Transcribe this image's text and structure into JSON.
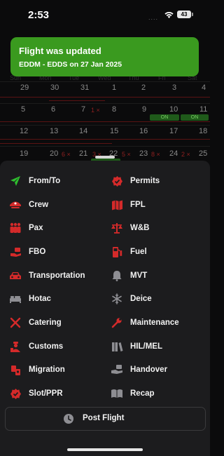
{
  "status_bar": {
    "time": "2:53",
    "signal": "....",
    "battery": "43"
  },
  "calendar": {
    "day_headers": [
      "Sun",
      "Mon",
      "Tue",
      "Wed",
      "Thu",
      "Fri",
      "Sat"
    ],
    "weeks": [
      [
        "29",
        "30",
        "31",
        "1",
        "2",
        "3",
        "4"
      ],
      [
        "5",
        "6",
        "7",
        "8",
        "9",
        "10",
        "11"
      ],
      [
        "12",
        "13",
        "14",
        "15",
        "16",
        "17",
        "18"
      ],
      [
        "19",
        "20",
        "21",
        "22",
        "23",
        "24",
        "25"
      ]
    ],
    "badges": {
      "w2_tue": "1 ×",
      "w4_mon": "6 ×",
      "w4_wed": "3 ×",
      "w4_thu": "5 ×",
      "w4_fri": "8 ×",
      "w4_sat": "2 ×"
    },
    "events": {
      "ev_fri": "ON",
      "ev_sat": "ON"
    }
  },
  "toast": {
    "title": "Flight was updated",
    "subtitle": "EDDM - EDDS on 27 Jan 2025"
  },
  "menu": {
    "left": [
      {
        "label": "From/To",
        "icon": "airplane-icon",
        "color": "#2fbf2f"
      },
      {
        "label": "Crew",
        "icon": "pilot-cap-icon",
        "color": "#d42a2a"
      },
      {
        "label": "Pax",
        "icon": "passengers-icon",
        "color": "#d42a2a"
      },
      {
        "label": "FBO",
        "icon": "hand-service-icon",
        "color": "#d42a2a"
      },
      {
        "label": "Transportation",
        "icon": "car-icon",
        "color": "#d42a2a"
      },
      {
        "label": "Hotac",
        "icon": "bed-icon",
        "color": "#8e8e93"
      },
      {
        "label": "Catering",
        "icon": "cutlery-icon",
        "color": "#d42a2a"
      },
      {
        "label": "Customs",
        "icon": "customs-officer-icon",
        "color": "#d42a2a"
      },
      {
        "label": "Migration",
        "icon": "passport-icon",
        "color": "#d42a2a"
      },
      {
        "label": "Slot/PPR",
        "icon": "check-badge-icon",
        "color": "#d42a2a"
      }
    ],
    "right": [
      {
        "label": "Permits",
        "icon": "permit-badge-icon",
        "color": "#d42a2a"
      },
      {
        "label": "FPL",
        "icon": "map-icon",
        "color": "#d42a2a"
      },
      {
        "label": "W&B",
        "icon": "balance-scale-icon",
        "color": "#d42a2a"
      },
      {
        "label": "Fuel",
        "icon": "fuel-pump-icon",
        "color": "#d42a2a"
      },
      {
        "label": "MVT",
        "icon": "bell-icon",
        "color": "#8e8e93"
      },
      {
        "label": "Deice",
        "icon": "snowflake-icon",
        "color": "#8e8e93"
      },
      {
        "label": "Maintenance",
        "icon": "wrench-icon",
        "color": "#d42a2a"
      },
      {
        "label": "HIL/MEL",
        "icon": "books-icon",
        "color": "#8e8e93"
      },
      {
        "label": "Handover",
        "icon": "handover-icon",
        "color": "#8e8e93"
      },
      {
        "label": "Recap",
        "icon": "open-book-icon",
        "color": "#8e8e93"
      }
    ]
  },
  "post_flight": {
    "label": "Post Flight",
    "icon": "clock-icon"
  }
}
